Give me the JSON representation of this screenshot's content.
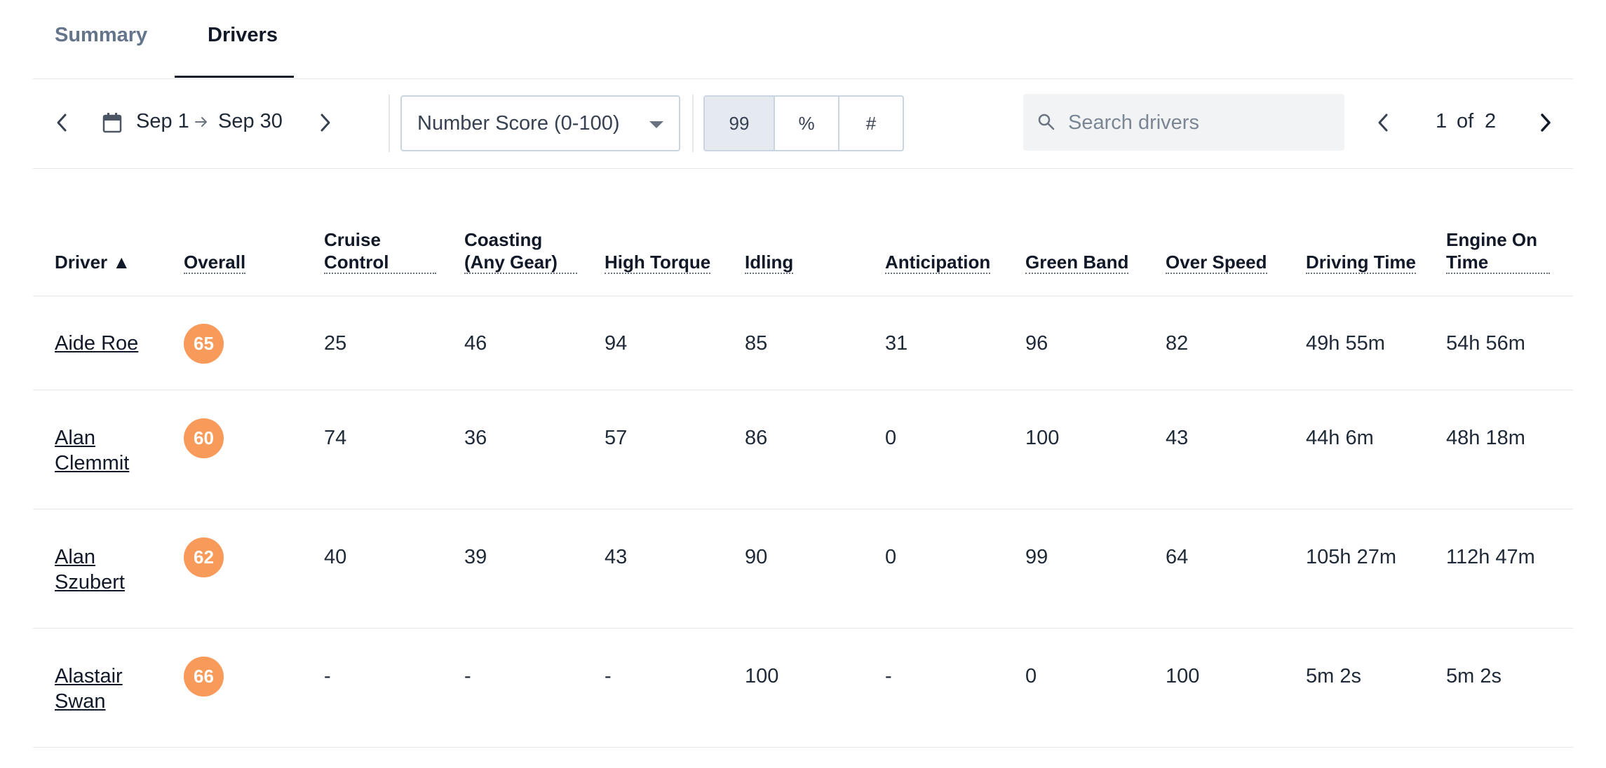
{
  "tabs": [
    {
      "label": "Summary"
    },
    {
      "label": "Drivers"
    }
  ],
  "toolbar": {
    "date_start": "Sep 1",
    "date_end": "Sep 30",
    "score_select": "Number Score (0-100)",
    "display_modes": [
      "99",
      "%",
      "#"
    ],
    "search_placeholder": "Search drivers",
    "page_current": "1",
    "page_of": "of",
    "page_total": "2"
  },
  "table": {
    "columns": [
      {
        "label": "Driver ▲"
      },
      {
        "label": "Overall"
      },
      {
        "label": "Cruise",
        "label2": "Control"
      },
      {
        "label": "Coasting",
        "label2": "(Any Gear)"
      },
      {
        "label": "High Torque"
      },
      {
        "label": "Idling"
      },
      {
        "label": "Anticipation"
      },
      {
        "label": "Green Band"
      },
      {
        "label": "Over Speed"
      },
      {
        "label": "Driving Time"
      },
      {
        "label": "Engine On",
        "label2": "Time"
      }
    ],
    "rows": [
      {
        "name1": "Aide Roe",
        "name2": "",
        "overall": "65",
        "cruise": "25",
        "coasting": "46",
        "torque": "94",
        "idling": "85",
        "anticipation": "31",
        "green": "96",
        "speed": "82",
        "driving": "49h 55m",
        "engine": "54h 56m"
      },
      {
        "name1": "Alan",
        "name2": "Clemmit",
        "overall": "60",
        "cruise": "74",
        "coasting": "36",
        "torque": "57",
        "idling": "86",
        "anticipation": "0",
        "green": "100",
        "speed": "43",
        "driving": "44h 6m",
        "engine": "48h 18m"
      },
      {
        "name1": "Alan",
        "name2": "Szubert",
        "overall": "62",
        "cruise": "40",
        "coasting": "39",
        "torque": "43",
        "idling": "90",
        "anticipation": "0",
        "green": "99",
        "speed": "64",
        "driving": "105h 27m",
        "engine": "112h 47m"
      },
      {
        "name1": "Alastair",
        "name2": "Swan",
        "overall": "66",
        "cruise": "-",
        "coasting": "-",
        "torque": "-",
        "idling": "100",
        "anticipation": "-",
        "green": "0",
        "speed": "100",
        "driving": "5m 2s",
        "engine": "5m 2s"
      }
    ]
  },
  "colors": {
    "badge": "#f79a5a",
    "text": "#1f2937",
    "muted": "#64748b",
    "border": "#e5e7eb"
  }
}
